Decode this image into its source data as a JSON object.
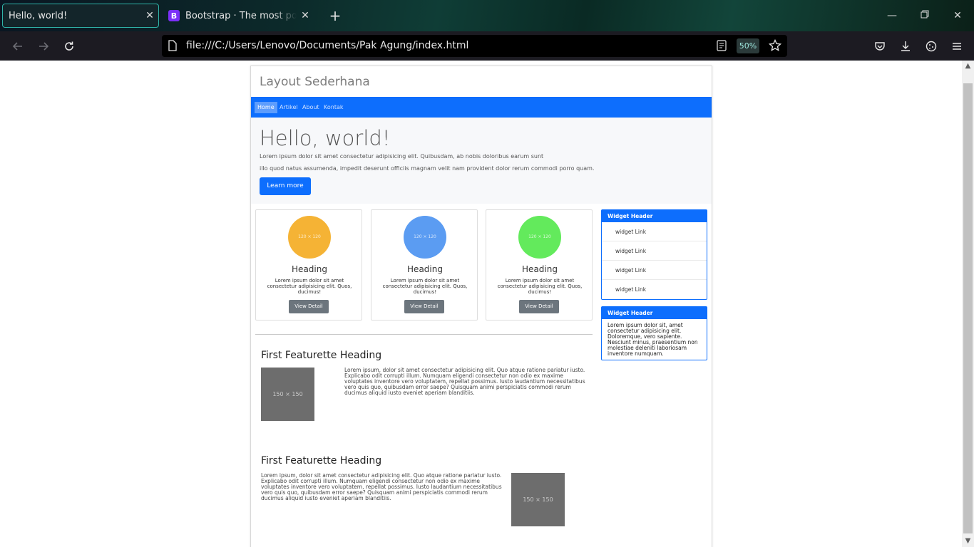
{
  "browser": {
    "tabs": [
      {
        "title": "Hello, world!",
        "active": true
      },
      {
        "title": "Bootstrap · The most popular HTML",
        "active": false,
        "favicon": "B"
      }
    ],
    "url": "file:///C:/Users/Lenovo/Documents/Pak Agung/index.html",
    "zoom": "50%",
    "accent": "#2fb3a8"
  },
  "page": {
    "site_title": "Layout Sederhana",
    "nav": [
      "Home",
      "Artikel",
      "About",
      "Kontak"
    ],
    "nav_active": "Home",
    "jumbotron": {
      "title": "Hello, world!",
      "line1": "Lorem ipsum dolor sit amet consectetur adipisicing elit. Quibusdam, ab nobis doloribus earum sunt",
      "line2": "illo quod natus assumenda, impedit deserunt officiis magnam velit nam provident dolor rerum commodi porro quam.",
      "button": "Learn more"
    },
    "cards": [
      {
        "placeholder": "120 × 120",
        "color": "#f5b335",
        "heading": "Heading",
        "text": "Lorem ipsum dolor sit amet consectetur adipisicing elit. Quos, ducimus!",
        "button": "View Detail"
      },
      {
        "placeholder": "120 × 120",
        "color": "#5b9cf2",
        "heading": "Heading",
        "text": "Lorem ipsum dolor sit amet consectetur adipisicing elit. Quos, ducimus!",
        "button": "View Detail"
      },
      {
        "placeholder": "120 × 120",
        "color": "#63ea5c",
        "heading": "Heading",
        "text": "Lorem ipsum dolor sit amet consectetur adipisicing elit. Quos, ducimus!",
        "button": "View Detail"
      }
    ],
    "widget1": {
      "header": "Widget Header",
      "links": [
        "widget Link",
        "widget Link",
        "widget Link",
        "widget Link"
      ]
    },
    "widget2": {
      "header": "Widget Header",
      "body": "Lorem ipsum dolor sit, amet consectetur adipisicing elit. Doloremque, vero sapiente. Nesciunt minus, praesentium non molestiae deleniti laboriosam inventore numquam."
    },
    "featurette1": {
      "heading": "First Featurette Heading",
      "image": "150 × 150",
      "text": "Lorem ipsum, dolor sit amet consectetur adipisicing elit. Quo atque ratione pariatur iusto. Explicabo odit corrupti illum. Numquam eligendi consectetur non odio ex maxime voluptates inventore vero voluptatem, repellat possimus. Iusto laudantium necessitatibus vero quis quo, quibusdam error saepe? Quisquam animi perspiciatis commodi rerum ducimus aliquid iusto eveniet aperiam blanditiis."
    },
    "featurette2": {
      "heading": "First Featurette Heading",
      "image": "150 × 150",
      "text": "Lorem ipsum, dolor sit amet consectetur adipisicing elit. Quo atque ratione pariatur iusto. Explicabo odit corrupti illum. Numquam eligendi consectetur non odio ex maxime voluptates inventore vero voluptatem, repellat possimus. Iusto laudantium necessitatibus vero quis quo, quibusdam error saepe? Quisquam animi perspiciatis commodi rerum ducimus aliquid iusto eveniet aperiam blanditiis."
    }
  }
}
